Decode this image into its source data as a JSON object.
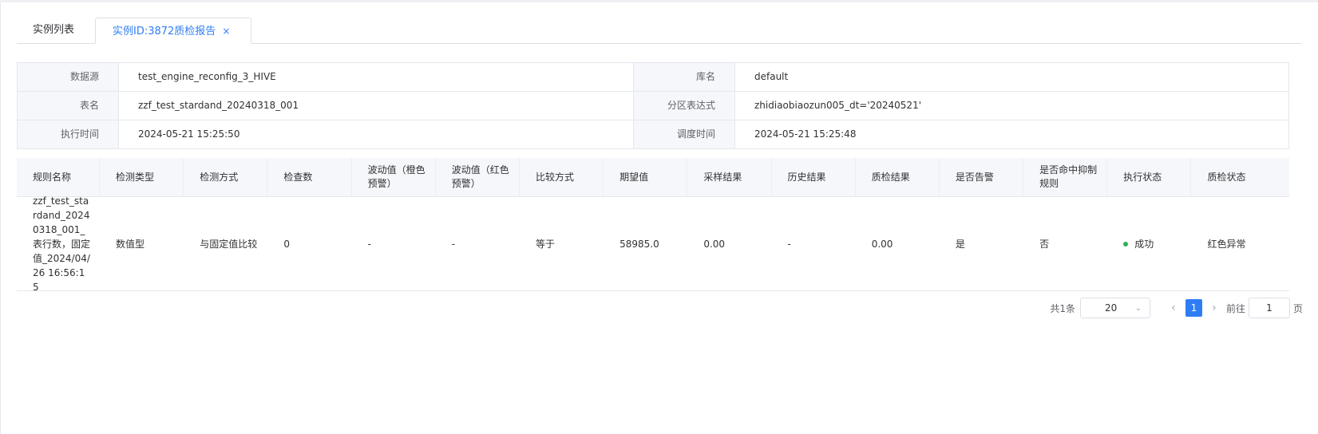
{
  "tabs": [
    {
      "label": "实例列表"
    },
    {
      "label": "实例ID:3872质检报告",
      "close": "×"
    }
  ],
  "info": {
    "rows": [
      {
        "label1": "数据源",
        "value1": "test_engine_reconfig_3_HIVE",
        "label2": "库名",
        "value2": "default"
      },
      {
        "label1": "表名",
        "value1": "zzf_test_stardand_20240318_001",
        "label2": "分区表达式",
        "value2": "zhidiaobiaozun005_dt='20240521'"
      },
      {
        "label1": "执行时间",
        "value1": "2024-05-21 15:25:50",
        "label2": "调度时间",
        "value2": "2024-05-21 15:25:48"
      }
    ]
  },
  "rules_table": {
    "headers": [
      "规则名称",
      "检测类型",
      "检测方式",
      "检查数",
      "波动值（橙色预警）",
      "波动值（红色预警）",
      "比较方式",
      "期望值",
      "采样结果",
      "历史结果",
      "质检结果",
      "是否告警",
      "是否命中抑制规则",
      "执行状态",
      "质检状态"
    ],
    "rows": [
      {
        "cells": [
          "zzf_test_stardand_20240318_001_表行数，固定值_2024/04/26 16:56:15",
          "数值型",
          "与固定值比较",
          "0",
          "-",
          "-",
          "等于",
          "58985.0",
          "0.00",
          "-",
          "0.00",
          "是",
          "否",
          "成功",
          "红色异常"
        ],
        "status_color": "#29b35a"
      }
    ]
  },
  "pagination": {
    "total": "共1条",
    "page_size": "20",
    "current_page": "1",
    "goto_label": "前往",
    "goto_value": "1",
    "page_suffix": "页"
  }
}
